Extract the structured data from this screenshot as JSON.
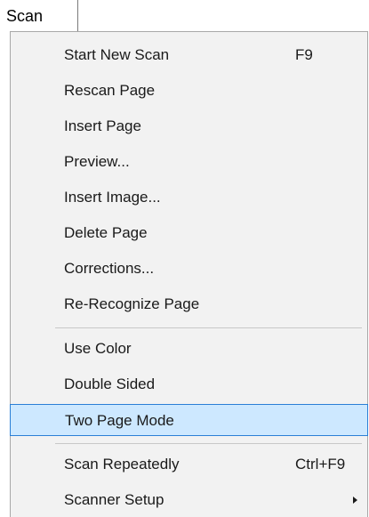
{
  "menubar": {
    "title": "Scan"
  },
  "menu": {
    "items": [
      {
        "label": "Start New Scan",
        "shortcut": "F9"
      },
      {
        "label": "Rescan Page"
      },
      {
        "label": "Insert Page"
      },
      {
        "label": "Preview..."
      },
      {
        "label": "Insert Image..."
      },
      {
        "label": "Delete Page"
      },
      {
        "label": "Corrections..."
      },
      {
        "label": "Re-Recognize Page"
      },
      {
        "label": "Use Color"
      },
      {
        "label": "Double Sided"
      },
      {
        "label": "Two Page Mode",
        "highlighted": true
      },
      {
        "label": "Scan Repeatedly",
        "shortcut": "Ctrl+F9"
      },
      {
        "label": "Scanner Setup",
        "submenu": true
      }
    ]
  },
  "colors": {
    "highlight_bg": "#cde8ff",
    "highlight_border": "#2b7fd6",
    "menu_bg": "#f2f2f2"
  }
}
